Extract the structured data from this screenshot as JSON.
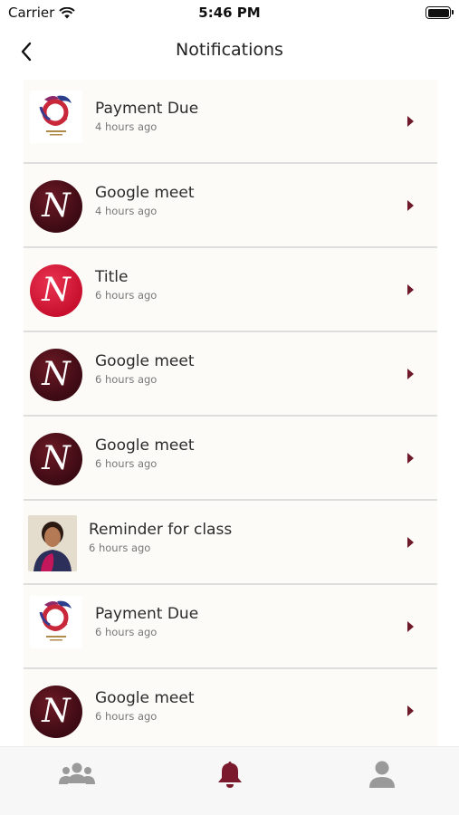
{
  "status_bar": {
    "carrier": "Carrier",
    "time": "5:46 PM"
  },
  "nav": {
    "title": "Notifications"
  },
  "notifications": [
    {
      "title": "Payment Due",
      "time": "4 hours ago",
      "avatar": "logo"
    },
    {
      "title": "Google meet",
      "time": "4 hours ago",
      "avatar": "dark-n"
    },
    {
      "title": "Title",
      "time": "6 hours ago",
      "avatar": "red-n"
    },
    {
      "title": "Google meet",
      "time": "6 hours ago",
      "avatar": "dark-n"
    },
    {
      "title": "Google meet",
      "time": "6 hours ago",
      "avatar": "dark-n"
    },
    {
      "title": "Reminder for class",
      "time": "6 hours ago",
      "avatar": "photo"
    },
    {
      "title": "Payment Due",
      "time": "6 hours ago",
      "avatar": "logo"
    },
    {
      "title": "Google meet",
      "time": "6 hours ago",
      "avatar": "dark-n"
    }
  ],
  "avatar_letter": "N",
  "tabs": [
    {
      "icon": "group-icon",
      "active": false
    },
    {
      "icon": "bell-icon",
      "active": true
    },
    {
      "icon": "person-icon",
      "active": false
    }
  ],
  "colors": {
    "accent": "#7a1a2c",
    "tab_inactive": "#9a9a9a",
    "dark_avatar": "#4a0f19",
    "red_avatar": "#d4163a"
  }
}
